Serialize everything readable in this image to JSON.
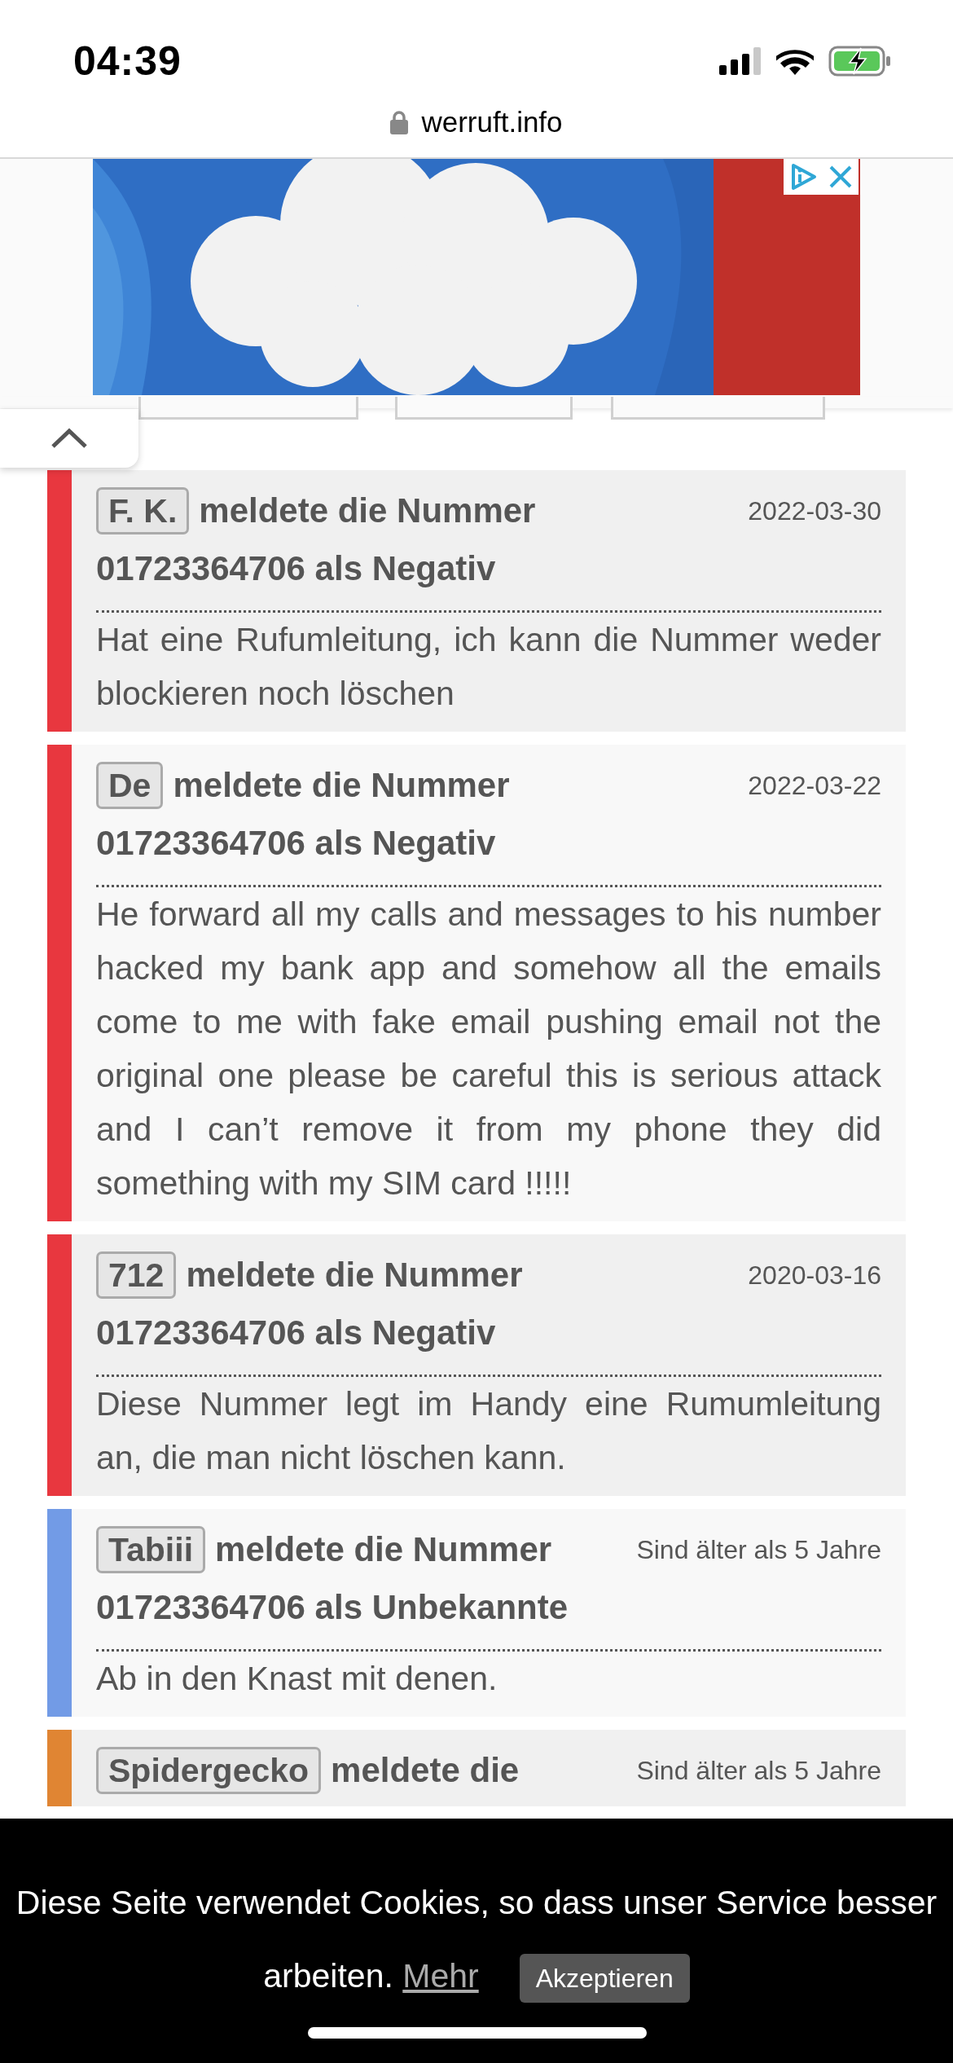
{
  "status_bar": {
    "time": "04:39"
  },
  "browser": {
    "url": "werruft.info"
  },
  "reports": [
    {
      "reporter": "F. K.",
      "action": "meldete die Nummer",
      "number_line": "01723364706 als Negativ",
      "date": "2022-03-30",
      "comment": "Hat eine Rufumleitung, ich kann die Nummer weder blockieren noch löschen",
      "color": "#e8373f"
    },
    {
      "reporter": "De",
      "action": "meldete die Nummer",
      "number_line": "01723364706 als Negativ",
      "date": "2022-03-22",
      "comment": "He forward all my calls and messages to his number hacked my bank app and somehow all the emails come to me with fake email pushing email not the original one please be careful this is serious attack and I can’t remove it from my phone they did something with my SIM card !!!!!",
      "color": "#e8373f"
    },
    {
      "reporter": "712",
      "action": "meldete die Nummer",
      "number_line": "01723364706 als Negativ",
      "date": "2020-03-16",
      "comment": "Diese Nummer legt im Handy eine Rumumleitung an, die man nicht löschen kann.",
      "color": "#e8373f"
    },
    {
      "reporter": "Tabiii",
      "action": "meldete die Nummer",
      "number_line": "01723364706 als Unbekannte",
      "date": "Sind älter als 5 Jahre",
      "comment": "Ab in den Knast mit denen.",
      "color": "#729be6"
    },
    {
      "reporter": "Spidergecko",
      "action": "meldete die",
      "date": "Sind älter als 5 Jahre",
      "color": "#e08533"
    }
  ],
  "cookie_banner": {
    "message": "Diese Seite verwendet Cookies, so dass unser Service besser arbeiten.",
    "link": "Mehr",
    "button": "Akzeptieren"
  }
}
